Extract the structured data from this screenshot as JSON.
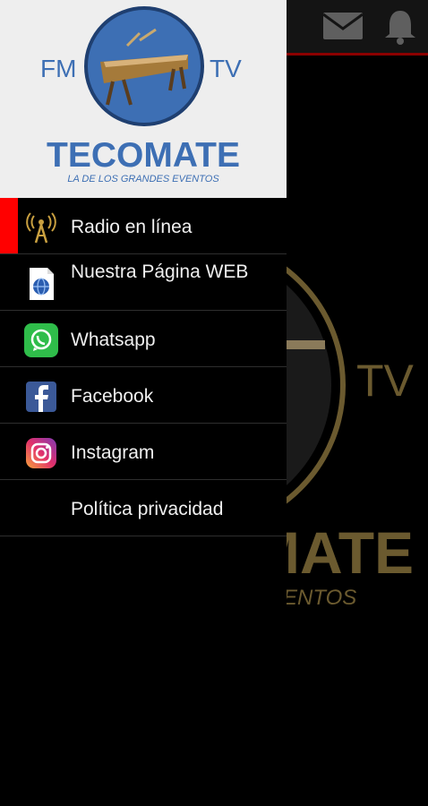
{
  "app": {
    "fm": "FM",
    "tv": "TV",
    "brand": "TECOMATE",
    "tagline": "LA DE LOS GRANDES EVENTOS"
  },
  "topbar": {
    "icons": [
      "mail-icon",
      "bell-icon"
    ]
  },
  "background": {
    "tv": "TV",
    "brand_fragment": "MATE",
    "tagline_fragment": "VENTOS"
  },
  "menu": [
    {
      "label": "Radio en línea",
      "icon": "radio-tower-icon",
      "active": true
    },
    {
      "label": "Nuestra Página WEB",
      "icon": "web-page-icon",
      "active": false
    },
    {
      "label": "Whatsapp",
      "icon": "whatsapp-icon",
      "active": false
    },
    {
      "label": "Facebook",
      "icon": "facebook-icon",
      "active": false
    },
    {
      "label": "Instagram",
      "icon": "instagram-icon",
      "active": false
    },
    {
      "label": "Política privacidad",
      "icon": "",
      "active": false
    }
  ],
  "colors": {
    "brand_blue": "#3d6fb4",
    "accent_red": "#ff0000",
    "bg_gold": "#6b5a2f"
  }
}
